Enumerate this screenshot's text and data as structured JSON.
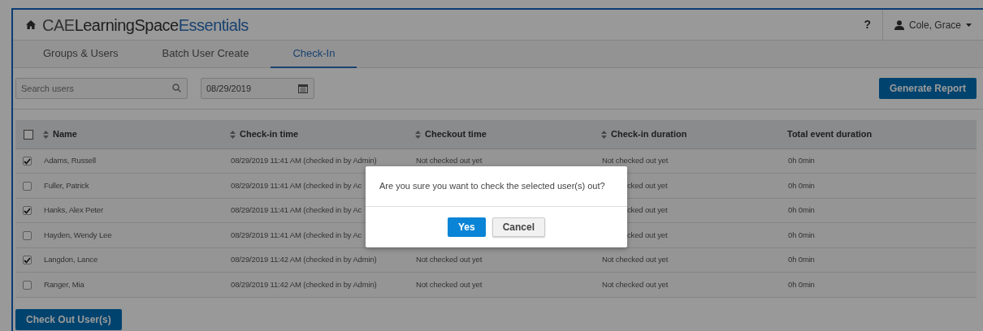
{
  "header": {
    "logo": {
      "prefix": "CAE",
      "name": "LearningSpace",
      "suffix": "Essentials"
    },
    "help": "?",
    "user": "Cole, Grace"
  },
  "tabs": [
    {
      "label": "Groups & Users",
      "selected": false
    },
    {
      "label": "Batch User Create",
      "selected": false
    },
    {
      "label": "Check-In",
      "selected": true
    }
  ],
  "toolbar": {
    "search": {
      "placeholder": "Search users"
    },
    "date": {
      "value": "08/29/2019"
    },
    "report_button": "Generate Report"
  },
  "table": {
    "select_all": {
      "checked": false
    },
    "columns": [
      {
        "label": "Name",
        "sortable": true
      },
      {
        "label": "Check-in time",
        "sortable": true
      },
      {
        "label": "Checkout time",
        "sortable": true
      },
      {
        "label": "Check-in duration",
        "sortable": true
      },
      {
        "label": "Total event duration",
        "sortable": false
      }
    ],
    "rows": [
      {
        "name": "Adams, Russell",
        "checked": true,
        "checkin_time": "08/29/2019 11:41 AM (checked in by Admin)",
        "checkout_time": "Not checked out yet",
        "checkin_duration": "Not checked out yet",
        "total": "0h 0min"
      },
      {
        "name": "Fuller, Patrick",
        "checked": false,
        "checkin_time": "08/29/2019 11:41 AM (checked in by Ac",
        "checkin_duration": "cked out yet",
        "total": "0h 0min"
      },
      {
        "name": "Hanks, Alex Peter",
        "checked": true,
        "checkin_time": "08/29/2019 11:41 AM (checked in by Ac",
        "checkin_duration": "cked out yet",
        "total": "0h 0min"
      },
      {
        "name": "Hayden, Wendy Lee",
        "checked": false,
        "checkin_time": "08/29/2019 11:41 AM (checked in by Ac",
        "checkin_duration": "cked out yet",
        "total": "0h 0min"
      },
      {
        "name": "Langdon, Lance",
        "checked": true,
        "checkin_time": "08/29/2019 11:42 AM (checked in by Admin)",
        "checkout_time": "Not checked out yet",
        "checkin_duration": "Not checked out yet",
        "total": "0h 0min"
      },
      {
        "name": "Ranger, Mia",
        "checked": false,
        "checkin_time": "08/29/2019 11:42 AM (checked in by Admin)",
        "checkout_time": "Not checked out yet",
        "checkin_duration": "Not checked out yet",
        "total": "0h 0min"
      }
    ]
  },
  "footer_button": "Check Out User(s)",
  "modal": {
    "message": "Are you sure you want to check the selected user(s) out?",
    "buttons": [
      {
        "label": "Yes",
        "kind": "primary"
      },
      {
        "label": "Cancel",
        "kind": "secondary"
      }
    ]
  }
}
